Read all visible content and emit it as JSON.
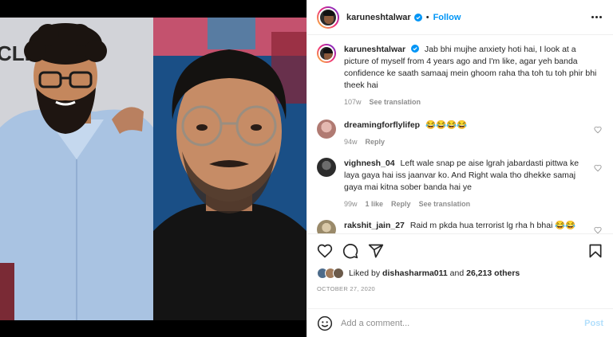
{
  "post": {
    "author": "karuneshtalwar",
    "separator": "•",
    "follow_label": "Follow",
    "caption": "Jab bhi mujhe anxiety hoti hai, I look at a picture of myself from 4 years ago and I'm like, agar yeh banda confidence ke saath samaaj mein ghoom raha tha toh tu toh phir bhi theek hai",
    "caption_age": "107w",
    "see_translation": "See translation",
    "media_banner_text": "CLI"
  },
  "comments": [
    {
      "username": "dreamingforflylifep",
      "text": "😂😂😂😂",
      "age": "94w",
      "reply_label": "Reply"
    },
    {
      "username": "vighnesh_04",
      "text": "Left wale snap pe aise lgrah jabardasti pittwa ke laya gaya hai iss jaanvar ko. And Right wala tho dhekke samaj gaya mai kitna sober banda hai ye",
      "age": "99w",
      "likes": "1 like",
      "reply_label": "Reply",
      "see_translation": "See translation"
    },
    {
      "username": "rakshit_jain_27",
      "text": "Raid m pkda hua terrorist lg rha h bhai 😂😂"
    }
  ],
  "likes": {
    "prefix": "Liked by",
    "user": "dishasharma011",
    "connector": "and",
    "count": "26,213 others"
  },
  "date": "OCTOBER 27, 2020",
  "add_comment": {
    "placeholder": "Add a comment...",
    "post_label": "Post"
  },
  "colors": {
    "link_blue": "#0095f6",
    "muted": "#8e8e8e",
    "text": "#262626"
  },
  "icons": [
    "verified-badge-icon",
    "more-options-icon",
    "heart-icon",
    "comment-icon",
    "share-icon",
    "bookmark-icon",
    "emoji-icon"
  ]
}
